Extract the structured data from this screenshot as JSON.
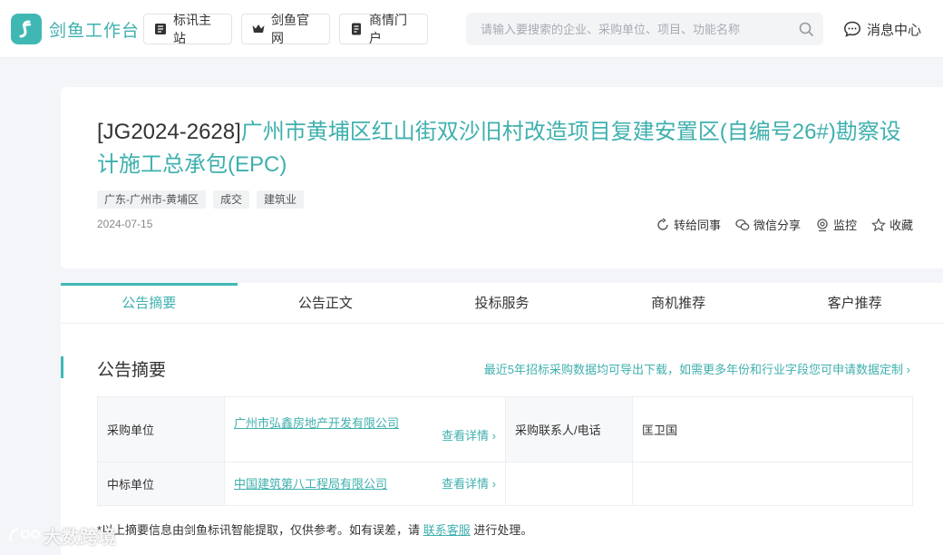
{
  "header": {
    "brand": "剑鱼工作台",
    "nav": [
      {
        "label": "标讯主站",
        "icon": "book-icon"
      },
      {
        "label": "剑鱼官网",
        "icon": "crown-icon"
      },
      {
        "label": "商情门户",
        "icon": "document-icon"
      }
    ],
    "search_placeholder": "请输入要搜索的企业、采购单位、项目、功能名称",
    "messages": "消息中心"
  },
  "notice": {
    "code": "[JG2024-2628]",
    "title": "广州市黄埔区红山街双沙旧村改造项目复建安置区(自编号26#)勘察设计施工总承包(EPC)",
    "tags": [
      "广东-广州市-黄埔区",
      "成交",
      "建筑业"
    ],
    "date": "2024-07-15",
    "actions": {
      "forward": "转给同事",
      "wechat": "微信分享",
      "monitor": "监控",
      "favorite": "收藏"
    }
  },
  "tabs": [
    "公告摘要",
    "公告正文",
    "投标服务",
    "商机推荐",
    "客户推荐"
  ],
  "summary": {
    "title": "公告摘要",
    "export_link": "最近5年招标采购数据均可导出下载，如需更多年份和行业字段您可申请数据定制",
    "purchaser_label": "采购单位",
    "purchaser": "广州市弘鑫房地产开发有限公司",
    "details": "查看详情",
    "contact_label": "采购联系人/电话",
    "contact": "匡卫国",
    "winner_label": "中标单位",
    "winner": "中国建筑第八工程局有限公司",
    "disclaimer_prefix": "*以上摘要信息由剑鱼标讯智能提取，仅供参考。如有误差，请",
    "disclaimer_link": "联系客服",
    "disclaimer_suffix": "进行处理。"
  },
  "watermark": "大数跨境",
  "colors": {
    "accent": "#3fb8b4"
  }
}
